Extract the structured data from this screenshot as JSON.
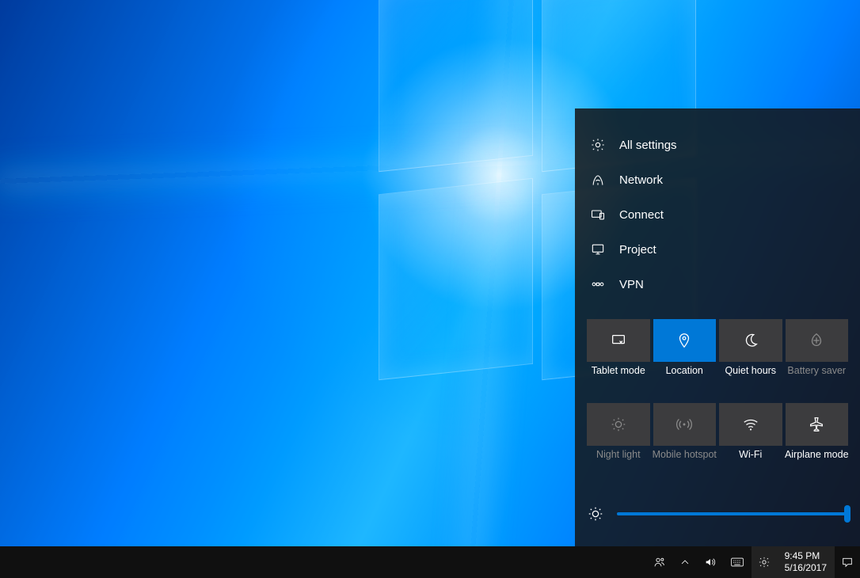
{
  "action_center": {
    "menu": [
      {
        "label": "All settings",
        "icon": "gear-icon"
      },
      {
        "label": "Network",
        "icon": "network-icon"
      },
      {
        "label": "Connect",
        "icon": "connect-icon"
      },
      {
        "label": "Project",
        "icon": "project-icon"
      },
      {
        "label": "VPN",
        "icon": "vpn-icon"
      }
    ],
    "quick_actions": [
      {
        "label": "Tablet mode",
        "state": "off"
      },
      {
        "label": "Location",
        "state": "on"
      },
      {
        "label": "Quiet hours",
        "state": "off"
      },
      {
        "label": "Battery saver",
        "state": "disabled"
      },
      {
        "label": "Night light",
        "state": "disabled"
      },
      {
        "label": "Mobile hotspot",
        "state": "disabled"
      },
      {
        "label": "Wi-Fi",
        "state": "off"
      },
      {
        "label": "Airplane mode",
        "state": "off"
      }
    ],
    "brightness_percent": 100
  },
  "taskbar": {
    "time": "9:45 PM",
    "date": "5/16/2017"
  }
}
